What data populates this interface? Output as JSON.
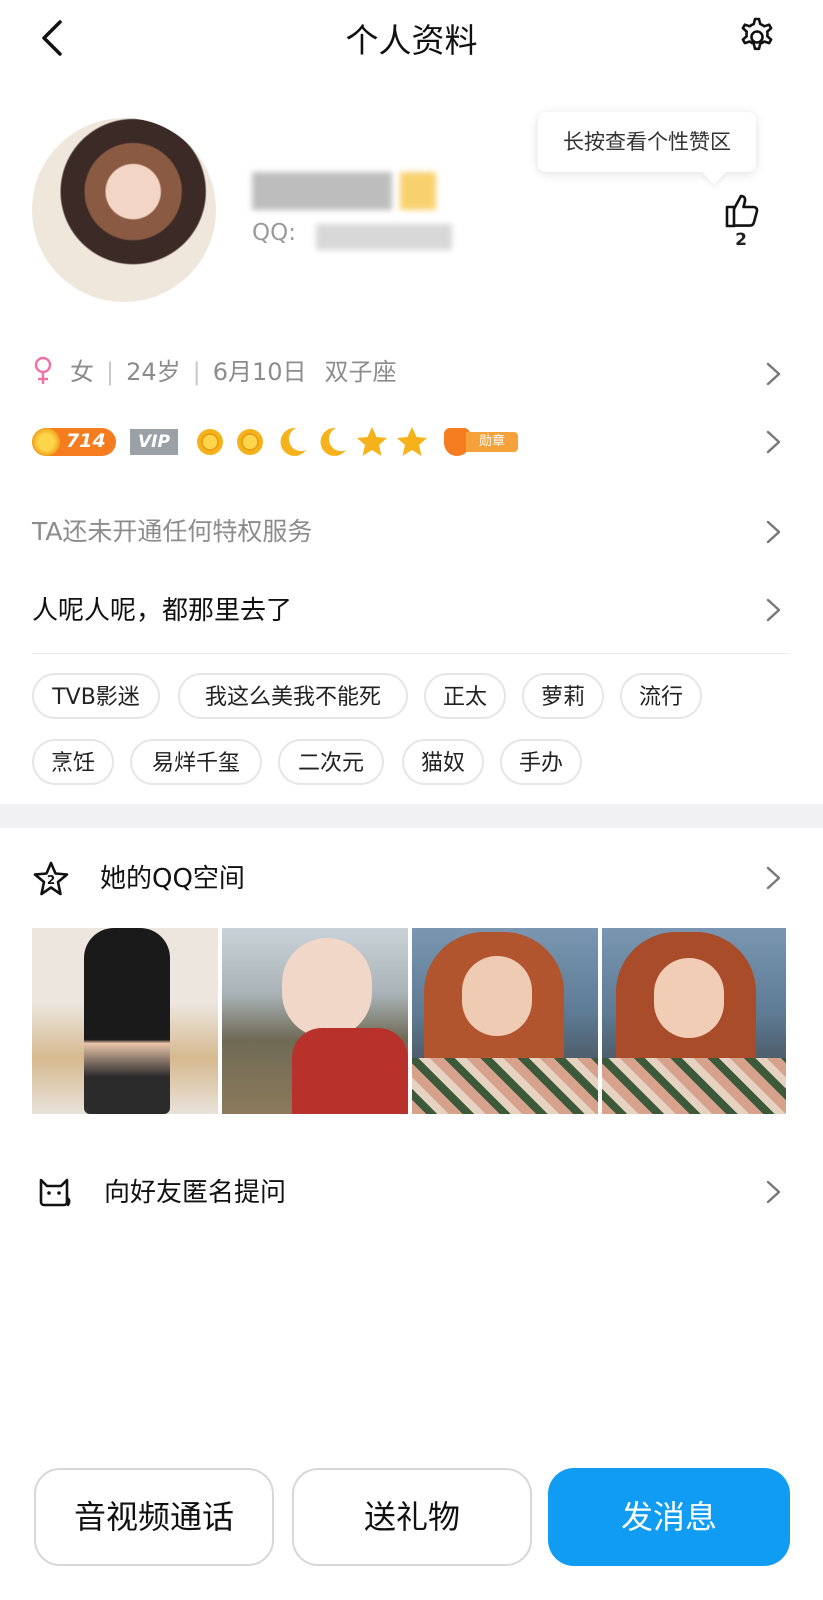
{
  "header": {
    "title": "个人资料",
    "back_icon": "chevron-left-icon",
    "settings_icon": "gear-icon"
  },
  "profile": {
    "qq_prefix": "QQ:",
    "tooltip": "长按查看个性赞区",
    "like_count": "2"
  },
  "basic_info": {
    "gender_icon": "female-icon",
    "gender": "女",
    "age": "24岁",
    "birthday": "6月10日",
    "zodiac": "双子座"
  },
  "badges": {
    "level_number": "714",
    "vip_label": "VIP",
    "medal_label": "勋章",
    "level_icons": [
      "sun-icon",
      "sun-icon",
      "moon-icon",
      "moon-icon",
      "star-icon",
      "star-icon"
    ]
  },
  "privilege_text": "TA还未开通任何特权服务",
  "signature": "人呢人呢，都那里去了",
  "tags": [
    "TVB影迷",
    "我这么美我不能死",
    "正太",
    "萝莉",
    "流行",
    "烹饪",
    "易烊千玺",
    "二次元",
    "猫奴",
    "手办"
  ],
  "qzone": {
    "icon": "qzone-star-icon",
    "title": "她的QQ空间",
    "photos": [
      "photo-1",
      "photo-2",
      "photo-3",
      "photo-4"
    ]
  },
  "anonymous": {
    "icon": "cat-icon",
    "title": "向好友匿名提问"
  },
  "actions": {
    "call_label": "音视频通话",
    "gift_label": "送礼物",
    "message_label": "发消息"
  },
  "colors": {
    "primary": "#0f9cf2",
    "gender_pink": "#f06fa5",
    "level_orange": "#f57c1f",
    "icon_gold": "#f5b21a"
  }
}
